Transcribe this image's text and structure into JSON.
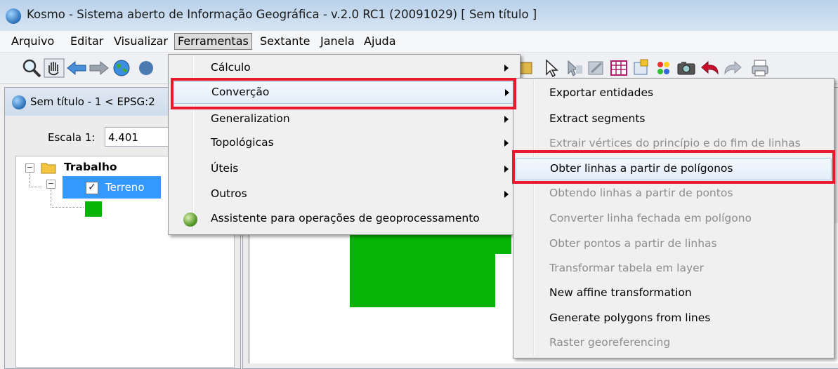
{
  "window": {
    "title": "Kosmo - Sistema aberto de Informação Geográfica - v.2.0 RC1 (20091029)  [ Sem título ]"
  },
  "menubar": [
    {
      "label": "Arquivo"
    },
    {
      "label": "Editar"
    },
    {
      "label": "Visualizar"
    },
    {
      "label": "Ferramentas"
    },
    {
      "label": "Sextante"
    },
    {
      "label": "Janela"
    },
    {
      "label": "Ajuda"
    }
  ],
  "toolbar": {
    "icons": [
      "zoom-icon",
      "pan-hand-icon",
      "back-arrow-icon",
      "forward-arrow-icon",
      "globe-icon",
      "select-arrow-icon",
      "feature-info-icon",
      "edit-icon",
      "table-icon",
      "layer-properties-icon",
      "colors-icon",
      "camera-icon",
      "undo-icon",
      "redo-icon",
      "print-icon"
    ]
  },
  "left_panel": {
    "title": "Sem título - 1 < EPSG:2",
    "scale_label": "Escala 1:",
    "scale_value": "4.401",
    "tree": {
      "root": "Trabalho",
      "layer": {
        "name": "Terreno",
        "checked": true,
        "swatch_color": "#06b406"
      }
    }
  },
  "menu_ferramentas": {
    "items": [
      {
        "label": "Cálculo",
        "submenu": true
      },
      {
        "label": "Converção",
        "submenu": true,
        "highlighted": true
      },
      {
        "label": "Generalization",
        "submenu": true
      },
      {
        "label": "Topológicas",
        "submenu": true
      },
      {
        "label": "Úteis",
        "submenu": true
      },
      {
        "label": "Outros",
        "submenu": true
      },
      {
        "label": "Assistente para operações de geoprocessamento",
        "submenu": false
      }
    ]
  },
  "submenu_conversao": {
    "items": [
      {
        "label": "Exportar entidades",
        "enabled": true
      },
      {
        "label": "Extract segments",
        "enabled": true
      },
      {
        "label": "Extrair vértices do princípio e do fim de linhas",
        "enabled": false
      },
      {
        "label": "Obter linhas a partir de polígonos",
        "enabled": true,
        "highlighted": true
      },
      {
        "label": "Obtendo linhas a partir de pontos",
        "enabled": false
      },
      {
        "label": "Converter linha fechada em polígono",
        "enabled": false
      },
      {
        "label": "Obter pontos a partir de linhas",
        "enabled": false
      },
      {
        "label": "Transformar tabela em layer",
        "enabled": false
      },
      {
        "label": "New affine transformation",
        "enabled": true
      },
      {
        "label": "Generate polygons from lines",
        "enabled": true
      },
      {
        "label": "Raster georeferencing",
        "enabled": false
      }
    ]
  },
  "colors": {
    "annotation_red": "#e8192c",
    "selection_blue": "#3399ff",
    "polygon_green": "#06b406"
  }
}
